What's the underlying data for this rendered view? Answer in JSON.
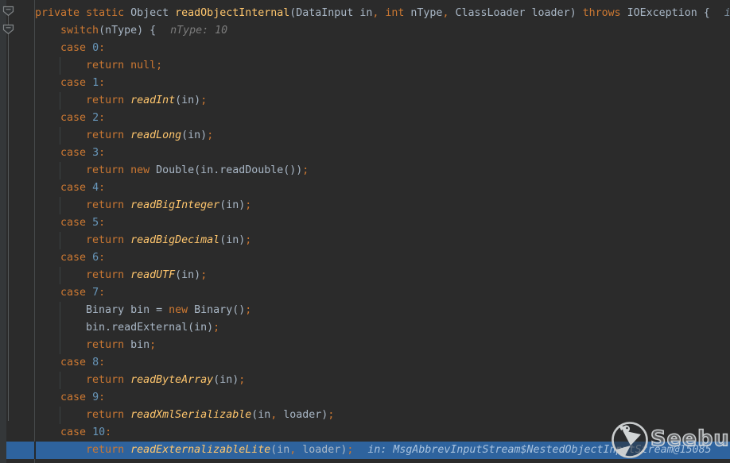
{
  "editor": {
    "background": "#2b2b2b",
    "execution_line_color": "#2e639e",
    "syntax_colors": {
      "keyword": "#cc7832",
      "number": "#6897bb",
      "method_call_italic": "#ffc66d",
      "method_declaration": "#ffc66d",
      "plain": "#a9b7c6",
      "punctuation": "#cc7832",
      "inline_hint": "#7c7c7c",
      "inline_hint_on_exec_line": "#a8c2de"
    },
    "lines": [
      {
        "tokens": [
          [
            "kw",
            "private"
          ],
          [
            "pl",
            " "
          ],
          [
            "kw",
            "static"
          ],
          [
            "pl",
            " Object "
          ],
          [
            "decl",
            "readObjectInternal"
          ],
          [
            "pl",
            "(DataInput in"
          ],
          [
            "op",
            ","
          ],
          [
            "pl",
            " "
          ],
          [
            "kw",
            "int"
          ],
          [
            "pl",
            " nType"
          ],
          [
            "op",
            ","
          ],
          [
            "pl",
            " ClassLoader loader) "
          ],
          [
            "kw",
            "throws"
          ],
          [
            "pl",
            " IOException {"
          ]
        ],
        "hint": {
          "text": "i",
          "tone": "dim"
        }
      },
      {
        "tokens": [
          [
            "pl",
            "    "
          ],
          [
            "kw",
            "switch"
          ],
          [
            "pl",
            "(nType) {"
          ]
        ],
        "hint": {
          "text": "nType: 10",
          "tone": "gray"
        }
      },
      {
        "tokens": [
          [
            "pl",
            "    "
          ],
          [
            "kw",
            "case"
          ],
          [
            "pl",
            " "
          ],
          [
            "num",
            "0"
          ],
          [
            "op",
            ":"
          ]
        ]
      },
      {
        "tokens": [
          [
            "pl",
            "        "
          ],
          [
            "kw",
            "return"
          ],
          [
            "pl",
            " "
          ],
          [
            "kw",
            "null"
          ],
          [
            "op",
            ";"
          ]
        ]
      },
      {
        "tokens": [
          [
            "pl",
            "    "
          ],
          [
            "kw",
            "case"
          ],
          [
            "pl",
            " "
          ],
          [
            "num",
            "1"
          ],
          [
            "op",
            ":"
          ]
        ]
      },
      {
        "tokens": [
          [
            "pl",
            "        "
          ],
          [
            "kw",
            "return"
          ],
          [
            "pl",
            " "
          ],
          [
            "call",
            "readInt"
          ],
          [
            "pl",
            "(in)"
          ],
          [
            "op",
            ";"
          ]
        ]
      },
      {
        "tokens": [
          [
            "pl",
            "    "
          ],
          [
            "kw",
            "case"
          ],
          [
            "pl",
            " "
          ],
          [
            "num",
            "2"
          ],
          [
            "op",
            ":"
          ]
        ]
      },
      {
        "tokens": [
          [
            "pl",
            "        "
          ],
          [
            "kw",
            "return"
          ],
          [
            "pl",
            " "
          ],
          [
            "call",
            "readLong"
          ],
          [
            "pl",
            "(in)"
          ],
          [
            "op",
            ";"
          ]
        ]
      },
      {
        "tokens": [
          [
            "pl",
            "    "
          ],
          [
            "kw",
            "case"
          ],
          [
            "pl",
            " "
          ],
          [
            "num",
            "3"
          ],
          [
            "op",
            ":"
          ]
        ]
      },
      {
        "tokens": [
          [
            "pl",
            "        "
          ],
          [
            "kw",
            "return"
          ],
          [
            "pl",
            " "
          ],
          [
            "kw",
            "new"
          ],
          [
            "pl",
            " Double(in.readDouble())"
          ],
          [
            "op",
            ";"
          ]
        ]
      },
      {
        "tokens": [
          [
            "pl",
            "    "
          ],
          [
            "kw",
            "case"
          ],
          [
            "pl",
            " "
          ],
          [
            "num",
            "4"
          ],
          [
            "op",
            ":"
          ]
        ]
      },
      {
        "tokens": [
          [
            "pl",
            "        "
          ],
          [
            "kw",
            "return"
          ],
          [
            "pl",
            " "
          ],
          [
            "call",
            "readBigInteger"
          ],
          [
            "pl",
            "(in)"
          ],
          [
            "op",
            ";"
          ]
        ]
      },
      {
        "tokens": [
          [
            "pl",
            "    "
          ],
          [
            "kw",
            "case"
          ],
          [
            "pl",
            " "
          ],
          [
            "num",
            "5"
          ],
          [
            "op",
            ":"
          ]
        ]
      },
      {
        "tokens": [
          [
            "pl",
            "        "
          ],
          [
            "kw",
            "return"
          ],
          [
            "pl",
            " "
          ],
          [
            "call",
            "readBigDecimal"
          ],
          [
            "pl",
            "(in)"
          ],
          [
            "op",
            ";"
          ]
        ]
      },
      {
        "tokens": [
          [
            "pl",
            "    "
          ],
          [
            "kw",
            "case"
          ],
          [
            "pl",
            " "
          ],
          [
            "num",
            "6"
          ],
          [
            "op",
            ":"
          ]
        ]
      },
      {
        "tokens": [
          [
            "pl",
            "        "
          ],
          [
            "kw",
            "return"
          ],
          [
            "pl",
            " "
          ],
          [
            "call",
            "readUTF"
          ],
          [
            "pl",
            "(in)"
          ],
          [
            "op",
            ";"
          ]
        ]
      },
      {
        "tokens": [
          [
            "pl",
            "    "
          ],
          [
            "kw",
            "case"
          ],
          [
            "pl",
            " "
          ],
          [
            "num",
            "7"
          ],
          [
            "op",
            ":"
          ]
        ]
      },
      {
        "tokens": [
          [
            "pl",
            "        Binary bin = "
          ],
          [
            "kw",
            "new"
          ],
          [
            "pl",
            " Binary()"
          ],
          [
            "op",
            ";"
          ]
        ]
      },
      {
        "tokens": [
          [
            "pl",
            "        bin.readExternal(in)"
          ],
          [
            "op",
            ";"
          ]
        ]
      },
      {
        "tokens": [
          [
            "pl",
            "        "
          ],
          [
            "kw",
            "return"
          ],
          [
            "pl",
            " bin"
          ],
          [
            "op",
            ";"
          ]
        ]
      },
      {
        "tokens": [
          [
            "pl",
            "    "
          ],
          [
            "kw",
            "case"
          ],
          [
            "pl",
            " "
          ],
          [
            "num",
            "8"
          ],
          [
            "op",
            ":"
          ]
        ]
      },
      {
        "tokens": [
          [
            "pl",
            "        "
          ],
          [
            "kw",
            "return"
          ],
          [
            "pl",
            " "
          ],
          [
            "call",
            "readByteArray"
          ],
          [
            "pl",
            "(in)"
          ],
          [
            "op",
            ";"
          ]
        ]
      },
      {
        "tokens": [
          [
            "pl",
            "    "
          ],
          [
            "kw",
            "case"
          ],
          [
            "pl",
            " "
          ],
          [
            "num",
            "9"
          ],
          [
            "op",
            ":"
          ]
        ]
      },
      {
        "tokens": [
          [
            "pl",
            "        "
          ],
          [
            "kw",
            "return"
          ],
          [
            "pl",
            " "
          ],
          [
            "call",
            "readXmlSerializable"
          ],
          [
            "pl",
            "(in"
          ],
          [
            "op",
            ","
          ],
          [
            "pl",
            " loader)"
          ],
          [
            "op",
            ";"
          ]
        ]
      },
      {
        "tokens": [
          [
            "pl",
            "    "
          ],
          [
            "kw",
            "case"
          ],
          [
            "pl",
            " "
          ],
          [
            "num",
            "10"
          ],
          [
            "op",
            ":"
          ]
        ]
      },
      {
        "highlighted": true,
        "tokens": [
          [
            "pl",
            "        "
          ],
          [
            "kw",
            "return"
          ],
          [
            "pl",
            " "
          ],
          [
            "call",
            "readExternalizableLite"
          ],
          [
            "pl",
            "(in"
          ],
          [
            "op",
            ","
          ],
          [
            "pl",
            " loader)"
          ],
          [
            "op",
            ";"
          ]
        ],
        "hint": {
          "text": "in: MsgAbbrevInputStream$NestedObjectInputStream@15085",
          "tone": "blue"
        }
      }
    ]
  },
  "gutter": {
    "fold_icons": [
      "fold-collapse-icon",
      "fold-collapse-icon"
    ]
  },
  "watermark": {
    "brand": "Seebug",
    "icon": "seebug-bird-icon"
  }
}
